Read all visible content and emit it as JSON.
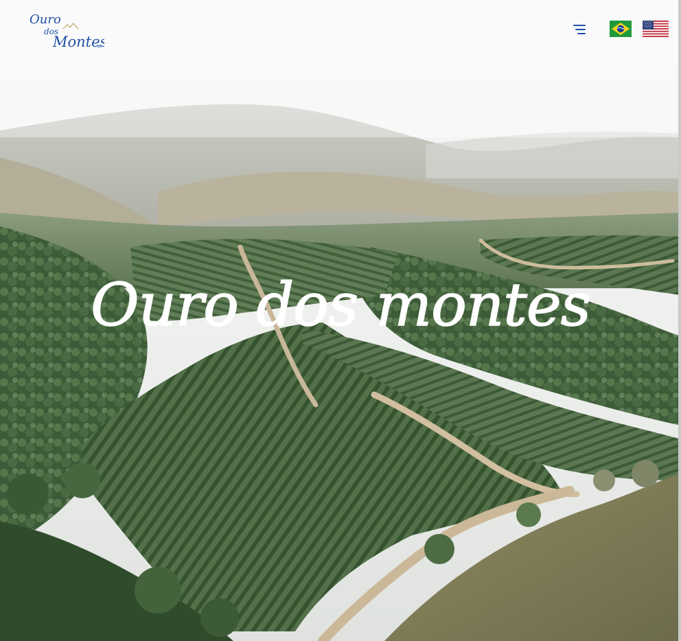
{
  "header": {
    "logo": {
      "line1": "Ouro",
      "line2": "dos",
      "line3": "Montes",
      "registered_mark": "®",
      "color": "#1f4fa8"
    },
    "menu_icon": "hamburger-menu-icon",
    "languages": [
      {
        "code": "pt-BR",
        "icon": "brazil-flag-icon"
      },
      {
        "code": "en-US",
        "icon": "usa-flag-icon"
      }
    ]
  },
  "hero": {
    "title": "Ouro dos montes",
    "title_color": "#ffffff",
    "image": "aerial-coffee-plantation-hills"
  },
  "colors": {
    "accent": "#1f4fa8",
    "sky": "#f3f4f3",
    "foliage": "#4a6a45"
  }
}
